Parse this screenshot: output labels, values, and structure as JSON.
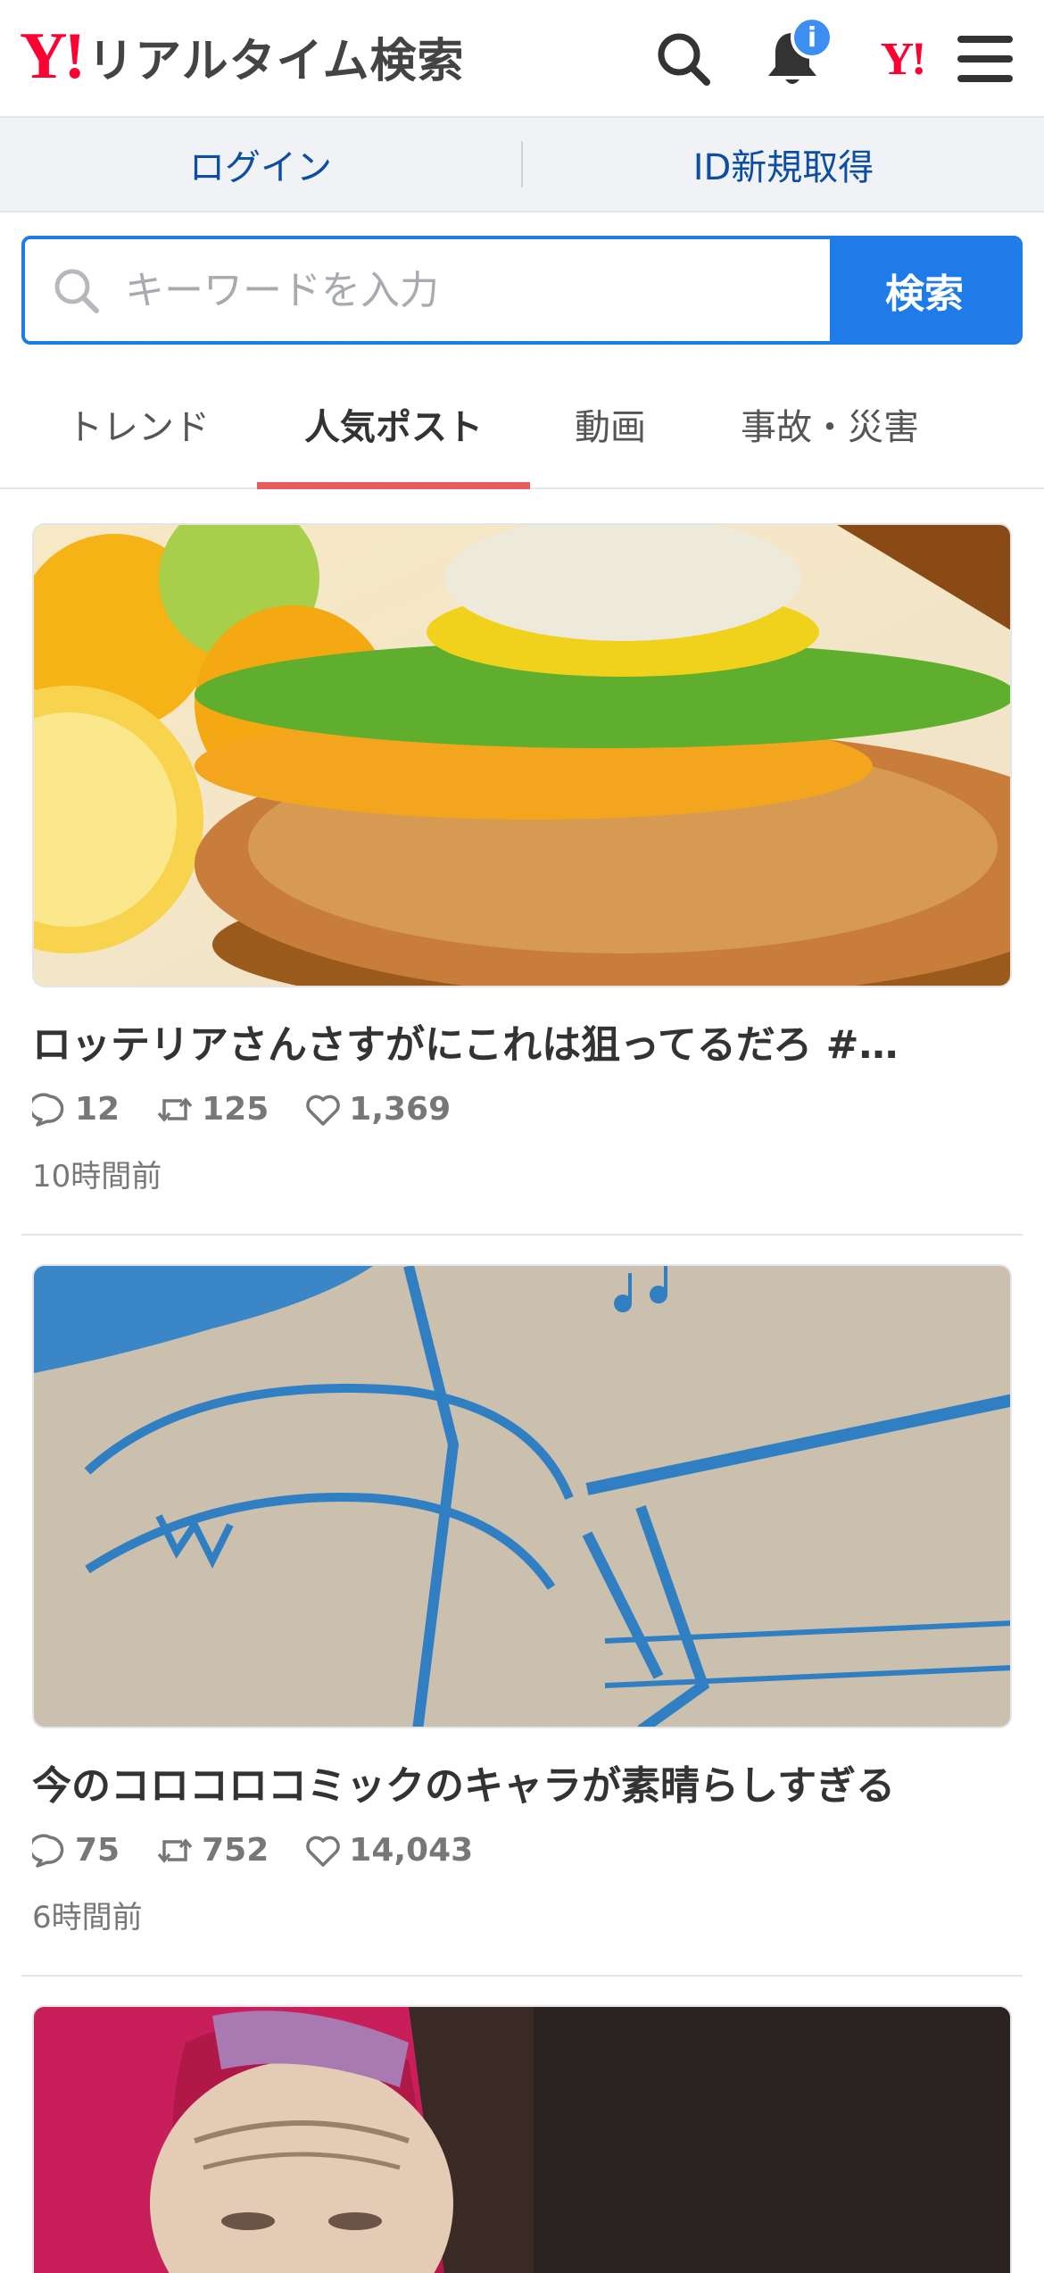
{
  "header": {
    "logo_y": "Y!",
    "logo_text": "リアルタイム検索",
    "notification_badge": "i",
    "yjapan_logo": "Y!"
  },
  "account": {
    "login_label": "ログイン",
    "register_label": "ID新規取得"
  },
  "search": {
    "placeholder": "キーワードを入力",
    "button_label": "検索"
  },
  "tabs": [
    {
      "label": "トレンド",
      "active": false
    },
    {
      "label": "人気ポスト",
      "active": true
    },
    {
      "label": "動画",
      "active": false
    },
    {
      "label": "事故・災害",
      "active": false
    }
  ],
  "posts": [
    {
      "title": "ロッテリアさんさすがにこれは狙ってるだろ #…",
      "replies": "12",
      "reposts": "125",
      "likes": "1,369",
      "time": "10時間前",
      "image": "fried-chicken-burger-with-lemon"
    },
    {
      "title": "今のコロコロコミックのキャラが素晴らしすぎる",
      "replies": "75",
      "reposts": "752",
      "likes": "14,043",
      "time": "6時間前",
      "image": "blue-manga-drawing-on-cardboard"
    },
    {
      "title": "",
      "image": "elderly-woman-with-red-headscarf"
    }
  ],
  "colors": {
    "accent_blue": "#1e7be8",
    "link_blue": "#0b4ea2",
    "yahoo_red": "#ff0033",
    "tab_indicator": "#e65b5b"
  }
}
